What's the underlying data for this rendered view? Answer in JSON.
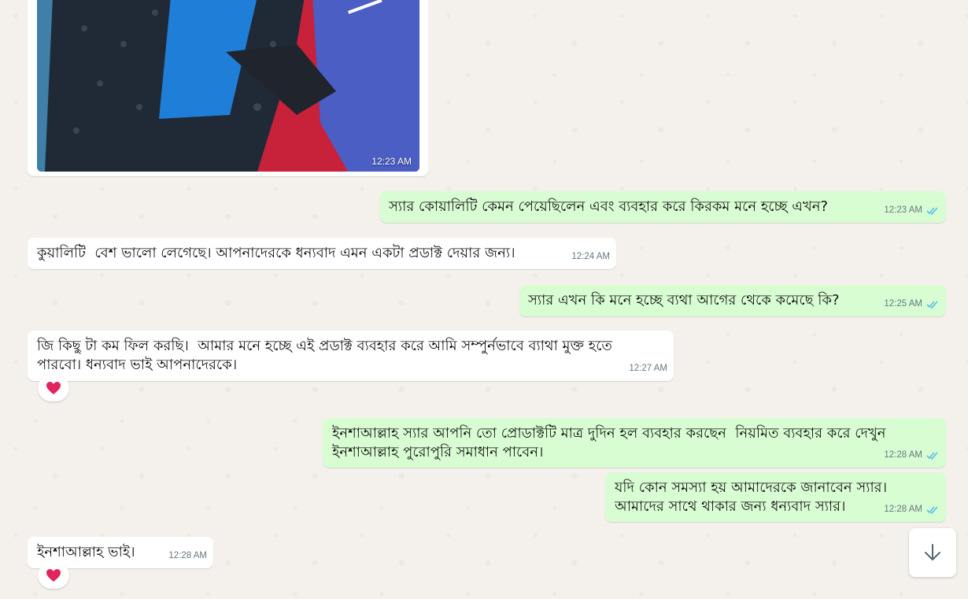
{
  "messages": [
    {
      "id": "m0",
      "type": "image",
      "direction": "in",
      "time": "12:23 AM"
    },
    {
      "id": "m1",
      "direction": "out",
      "text": "স্যার কোয়ালিটি কেমন পেয়েছিলেন এবং ব্যবহার করে কিরকম মনে হচ্ছে এখন?",
      "time": "12:23 AM",
      "status": "read"
    },
    {
      "id": "m2",
      "direction": "in",
      "text": "কুয়ালিটি  বেশ ভালো লেগেছে। আপনাদেরকে ধন্যবাদ এমন একটা প্রডাক্ট দেয়ার জন্য।",
      "time": "12:24 AM"
    },
    {
      "id": "m3",
      "direction": "out",
      "text": "স্যার এখন কি মনে হচ্ছে ব্যথা আগের থেকে কমেছে কি?",
      "time": "12:25 AM",
      "status": "read"
    },
    {
      "id": "m4",
      "direction": "in",
      "text": "জি কিছু টা কম ফিল করছি।  আমার মনে হচ্ছে এই প্রডাক্ট ব্যবহার করে আমি সম্পুর্নভাবে ব্যাথা মুক্ত হতে পারবো। ধন্যবাদ ভাই আপনাদেরকে।",
      "time": "12:27 AM",
      "reaction": "heart"
    },
    {
      "id": "m5",
      "direction": "out",
      "text": "ইনশাআল্লাহ স্যার আপনি তো প্রোডাক্টটি মাত্র দুদিন হল ব্যবহার করছেন  নিয়মিত ব্যবহার করে দেখুন ইনশাআল্লাহ পুরোপুরি সমাধান পাবেন।",
      "time": "12:28 AM",
      "status": "read"
    },
    {
      "id": "m6",
      "direction": "out",
      "text": "যদি কোন সমস্যা হয় আমাদেরকে জানাবেন স্যার।\nআমাদের সাথে থাকার জন্য ধন্যবাদ স্যার।",
      "time": "12:28 AM",
      "status": "read"
    },
    {
      "id": "m7",
      "direction": "in",
      "text": "ইনশাআল্লাহ ভাই।",
      "time": "12:28 AM",
      "reaction": "heart"
    }
  ],
  "colors": {
    "incoming": "#ffffff",
    "outgoing": "#d9fdd3",
    "read_tick": "#53bdeb",
    "reaction": "#e0245e"
  },
  "icons": {
    "read": "double-check-icon",
    "reaction": "heart-icon",
    "scroll": "arrow-down-icon"
  }
}
